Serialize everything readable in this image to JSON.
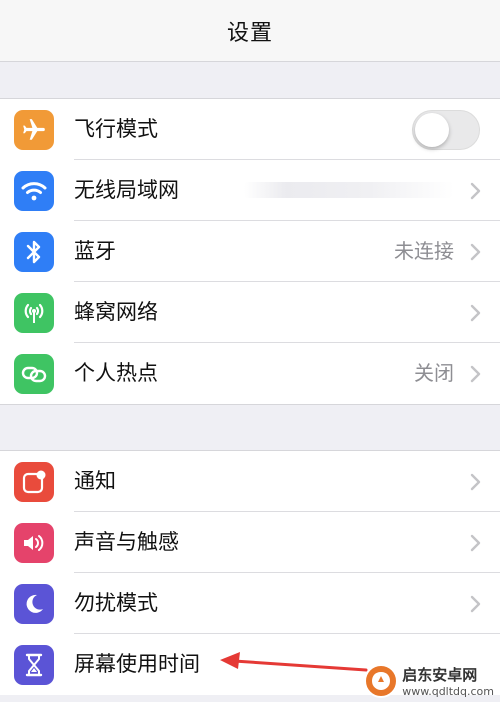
{
  "nav": {
    "title": "设置"
  },
  "group1": [
    {
      "id": "airplane",
      "label": "飞行模式",
      "icon": "airplane-icon",
      "icon_color": "#f19a37",
      "accessory": "toggle",
      "toggle_on": false
    },
    {
      "id": "wifi",
      "label": "无线局域网",
      "icon": "wifi-icon",
      "icon_color": "#2f7ef6",
      "accessory": "chevron",
      "value": ""
    },
    {
      "id": "bluetooth",
      "label": "蓝牙",
      "icon": "bluetooth-icon",
      "icon_color": "#2f7ef6",
      "accessory": "chevron",
      "value": "未连接"
    },
    {
      "id": "cellular",
      "label": "蜂窝网络",
      "icon": "cellular-antenna-icon",
      "icon_color": "#3fc463",
      "accessory": "chevron",
      "value": ""
    },
    {
      "id": "hotspot",
      "label": "个人热点",
      "icon": "hotspot-link-icon",
      "icon_color": "#3fc463",
      "accessory": "chevron",
      "value": "关闭"
    }
  ],
  "group2": [
    {
      "id": "notifications",
      "label": "通知",
      "icon": "notifications-icon",
      "icon_color": "#e94b3c",
      "accessory": "chevron"
    },
    {
      "id": "sounds",
      "label": "声音与触感",
      "icon": "speaker-icon",
      "icon_color": "#e5436b",
      "accessory": "chevron"
    },
    {
      "id": "dnd",
      "label": "勿扰模式",
      "icon": "moon-icon",
      "icon_color": "#5b54d6",
      "accessory": "chevron"
    },
    {
      "id": "screentime",
      "label": "屏幕使用时间",
      "icon": "hourglass-icon",
      "icon_color": "#5b54d6",
      "accessory": "none"
    }
  ],
  "annotation": {
    "arrow_color": "#e53935"
  },
  "watermark": {
    "title": "启东安卓网",
    "url": "www.qdltdq.com"
  }
}
